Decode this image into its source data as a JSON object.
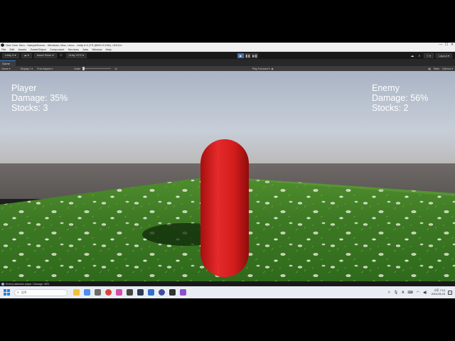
{
  "window": {
    "title": "One Over Zero - SampleScene - Windows, Mac, Linux - Unity 6.0 (TS (6000.0.23f1) <DX12>",
    "controls": [
      "—",
      "☐",
      "✕"
    ]
  },
  "menubar": {
    "items": [
      "File",
      "Edit",
      "Assets",
      "GameObject",
      "Component",
      "Services",
      "Jobs",
      "Window",
      "Help"
    ]
  },
  "toolbar": {
    "account_label": "Unity 6 ▾",
    "cloud_label": "☁ ▾",
    "asset_store_label": "Asset Store ▾",
    "vcs_label": "Unity VCS ▾",
    "layout_label": "Layout ▾",
    "play_icons": [
      "▶",
      "❚❚",
      "▶❚"
    ]
  },
  "tabs": {
    "game_label": "Game"
  },
  "gameview": {
    "mode_label": "Game ▾",
    "display_label": "Display 1 ▾",
    "aspect_label": "Free Aspect ▾",
    "scale_label": "Scale",
    "scale_value": "1x",
    "play_focused_label": "Play Focused ▾",
    "stats_label": "Stats",
    "gizmos_label": "Gizmos ▾",
    "scale_fraction": 0.0
  },
  "hud": {
    "player": {
      "name": "Player",
      "damage": "Damage: 35%",
      "stocks": "Stocks: 3"
    },
    "enemy": {
      "name": "Enemy",
      "damage": "Damage: 56%",
      "stocks": "Stocks: 2"
    }
  },
  "status": {
    "message": "Enemy attacked player. Damage: 35%"
  },
  "taskbar": {
    "search_placeholder": "검색",
    "tray_lang": "A",
    "time": "오후 7:14",
    "date": "2024-08-15",
    "notification_count": "2"
  },
  "colors": {
    "capsule": "#d61e1e",
    "accent": "#3a79bb"
  }
}
